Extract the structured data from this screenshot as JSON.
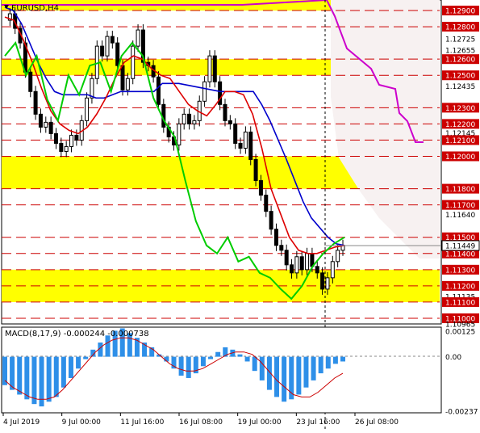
{
  "chart_data": [
    {
      "type": "candlestick",
      "symbol_label": "EURUSD,H4",
      "ylim": [
        1.10965,
        1.12965
      ],
      "price_tick_labels": [
        {
          "value": 1.129,
          "text": "1.12900",
          "hl": true
        },
        {
          "value": 1.128,
          "text": "1.12800",
          "hl": true
        },
        {
          "value": 1.12725,
          "text": "1.12725"
        },
        {
          "value": 1.12655,
          "text": "1.12655"
        },
        {
          "value": 1.126,
          "text": "1.12600",
          "hl": true
        },
        {
          "value": 1.125,
          "text": "1.12500",
          "hl": true
        },
        {
          "value": 1.12435,
          "text": "1.12435"
        },
        {
          "value": 1.123,
          "text": "1.12300",
          "hl": true
        },
        {
          "value": 1.122,
          "text": "1.12200",
          "hl": true
        },
        {
          "value": 1.12145,
          "text": "1.12145"
        },
        {
          "value": 1.121,
          "text": "1.12100",
          "hl": true
        },
        {
          "value": 1.12,
          "text": "1.12000",
          "hl": true
        },
        {
          "value": 1.118,
          "text": "1.11800",
          "hl": true
        },
        {
          "value": 1.117,
          "text": "1.11700",
          "hl": true
        },
        {
          "value": 1.1164,
          "text": "1.11640"
        },
        {
          "value": 1.115,
          "text": "1.11500",
          "hl": true
        },
        {
          "value": 1.114,
          "text": "1.11400",
          "hl": true
        },
        {
          "value": 1.113,
          "text": "1.11300",
          "hl": true
        },
        {
          "value": 1.112,
          "text": "1.11200",
          "hl": true
        },
        {
          "value": 1.11135,
          "text": "1.11135"
        },
        {
          "value": 1.111,
          "text": "1.11100",
          "hl": true
        },
        {
          "value": 1.11,
          "text": "1.11000",
          "hl": true
        },
        {
          "value": 1.10965,
          "text": "1.10965"
        }
      ],
      "current_price": {
        "value": 1.11449,
        "text": "1.11449"
      },
      "horizontal_levels": [
        1.129,
        1.128,
        1.126,
        1.125,
        1.123,
        1.122,
        1.121,
        1.12,
        1.118,
        1.117,
        1.115,
        1.114,
        1.113,
        1.112,
        1.111,
        1.11
      ],
      "yellow_zones": [
        [
          1.129,
          1.13
        ],
        [
          1.126,
          1.125
        ],
        [
          1.12,
          1.118
        ],
        [
          1.113,
          1.111
        ]
      ],
      "time_labels": [
        "4 Jul 2019",
        "9 Jul 00:00",
        "11 Jul 16:00",
        "16 Jul 08:00",
        "19 Jul 00:00",
        "23 Jul 16:00",
        "26 Jul 08:00"
      ],
      "close_series": [
        1.1284,
        1.1288,
        1.1279,
        1.127,
        1.1252,
        1.124,
        1.1226,
        1.1218,
        1.1221,
        1.1214,
        1.1208,
        1.1203,
        1.1206,
        1.1213,
        1.121,
        1.1222,
        1.1236,
        1.1248,
        1.1268,
        1.1262,
        1.1274,
        1.127,
        1.1256,
        1.1241,
        1.1248,
        1.1268,
        1.1278,
        1.1258,
        1.1256,
        1.1249,
        1.1232,
        1.1218,
        1.1212,
        1.1207,
        1.122,
        1.1226,
        1.122,
        1.1222,
        1.1234,
        1.1246,
        1.1262,
        1.1246,
        1.1232,
        1.1222,
        1.122,
        1.1208,
        1.1205,
        1.1215,
        1.1198,
        1.1185,
        1.1176,
        1.1166,
        1.1155,
        1.1145,
        1.1142,
        1.1133,
        1.1128,
        1.1138,
        1.113,
        1.114,
        1.1132,
        1.1128,
        1.1118,
        1.1125,
        1.1135,
        1.1142,
        1.1145
      ],
      "line_series": [
        {
          "color": "#0000cc",
          "name": "",
          "values": [
            1.1292,
            1.129,
            1.1282,
            1.127,
            1.1258,
            1.1248,
            1.124,
            1.1238,
            1.1238,
            1.1238,
            1.1238,
            1.1236,
            1.1236,
            1.1238,
            1.124,
            1.124,
            1.124,
            1.124,
            1.124,
            1.1245,
            1.1245,
            1.1245,
            1.1244,
            1.1243,
            1.1242,
            1.1241,
            1.124,
            1.124,
            1.124,
            1.124,
            1.124,
            1.1232,
            1.1222,
            1.121,
            1.1198,
            1.1185,
            1.1172,
            1.1162,
            1.1156,
            1.115,
            1.1146,
            1.1145
          ]
        },
        {
          "color": "#dd0000",
          "name": "",
          "values": [
            1.1286,
            1.1284,
            1.1272,
            1.1258,
            1.1242,
            1.1228,
            1.122,
            1.1216,
            1.1214,
            1.1218,
            1.1226,
            1.1236,
            1.1248,
            1.1258,
            1.1262,
            1.126,
            1.1254,
            1.125,
            1.1248,
            1.124,
            1.1232,
            1.1228,
            1.1225,
            1.1232,
            1.124,
            1.124,
            1.1238,
            1.1226,
            1.1205,
            1.118,
            1.1165,
            1.115,
            1.1142,
            1.114,
            1.114,
            1.1142,
            1.1144,
            1.1145
          ]
        },
        {
          "color": "#00cc00",
          "name": "",
          "values": [
            1.1262,
            1.127,
            1.125,
            1.1262,
            1.1235,
            1.1222,
            1.125,
            1.1238,
            1.1256,
            1.1258,
            1.124,
            1.1262,
            1.127,
            1.1262,
            1.1236,
            1.1222,
            1.1212,
            1.1185,
            1.116,
            1.1145,
            1.114,
            1.115,
            1.1135,
            1.1138,
            1.1128,
            1.1125,
            1.1118,
            1.1112,
            1.112,
            1.1132,
            1.114,
            1.1146,
            1.115
          ]
        }
      ]
    },
    {
      "type": "histogram",
      "title": "MACD(8,17,9) -0.000244 -0.000738",
      "ylim": [
        -0.00237,
        0.00125
      ],
      "tick_labels": [
        {
          "value": 0.00125,
          "text": "0.00125"
        },
        {
          "value": 0.0,
          "text": "0.00"
        },
        {
          "value": -0.00237,
          "text": "-0.00237"
        }
      ],
      "histogram": [
        -0.0012,
        -0.0014,
        -0.0016,
        -0.0018,
        -0.002,
        -0.0021,
        -0.0019,
        -0.0017,
        -0.0013,
        -0.0009,
        -0.0005,
        -0.0001,
        0.0003,
        0.0006,
        0.0009,
        0.0011,
        0.0012,
        0.001,
        0.0008,
        0.0006,
        0.0004,
        0.0001,
        -0.0002,
        -0.0005,
        -0.0008,
        -0.0009,
        -0.0007,
        -0.0004,
        -0.0001,
        0.0002,
        0.0004,
        0.0003,
        0.0001,
        -0.0002,
        -0.0006,
        -0.001,
        -0.0014,
        -0.0017,
        -0.0019,
        -0.0018,
        -0.0016,
        -0.0013,
        -0.001,
        -0.0007,
        -0.0005,
        -0.0003,
        -0.0002
      ],
      "signal": [
        -0.001,
        -0.0013,
        -0.0015,
        -0.0017,
        -0.0018,
        -0.0018,
        -0.0017,
        -0.0014,
        -0.001,
        -0.0006,
        -0.0002,
        0.0002,
        0.0005,
        0.0007,
        0.0008,
        0.0008,
        0.0007,
        0.0005,
        0.0003,
        0.0,
        -0.0003,
        -0.0005,
        -0.0006,
        -0.0006,
        -0.0005,
        -0.0003,
        -0.0001,
        0.0001,
        0.0002,
        0.0002,
        0.0001,
        -0.0002,
        -0.0006,
        -0.001,
        -0.0013,
        -0.0016,
        -0.0017,
        -0.0017,
        -0.0015,
        -0.0012,
        -0.0009,
        -0.0007
      ]
    }
  ]
}
